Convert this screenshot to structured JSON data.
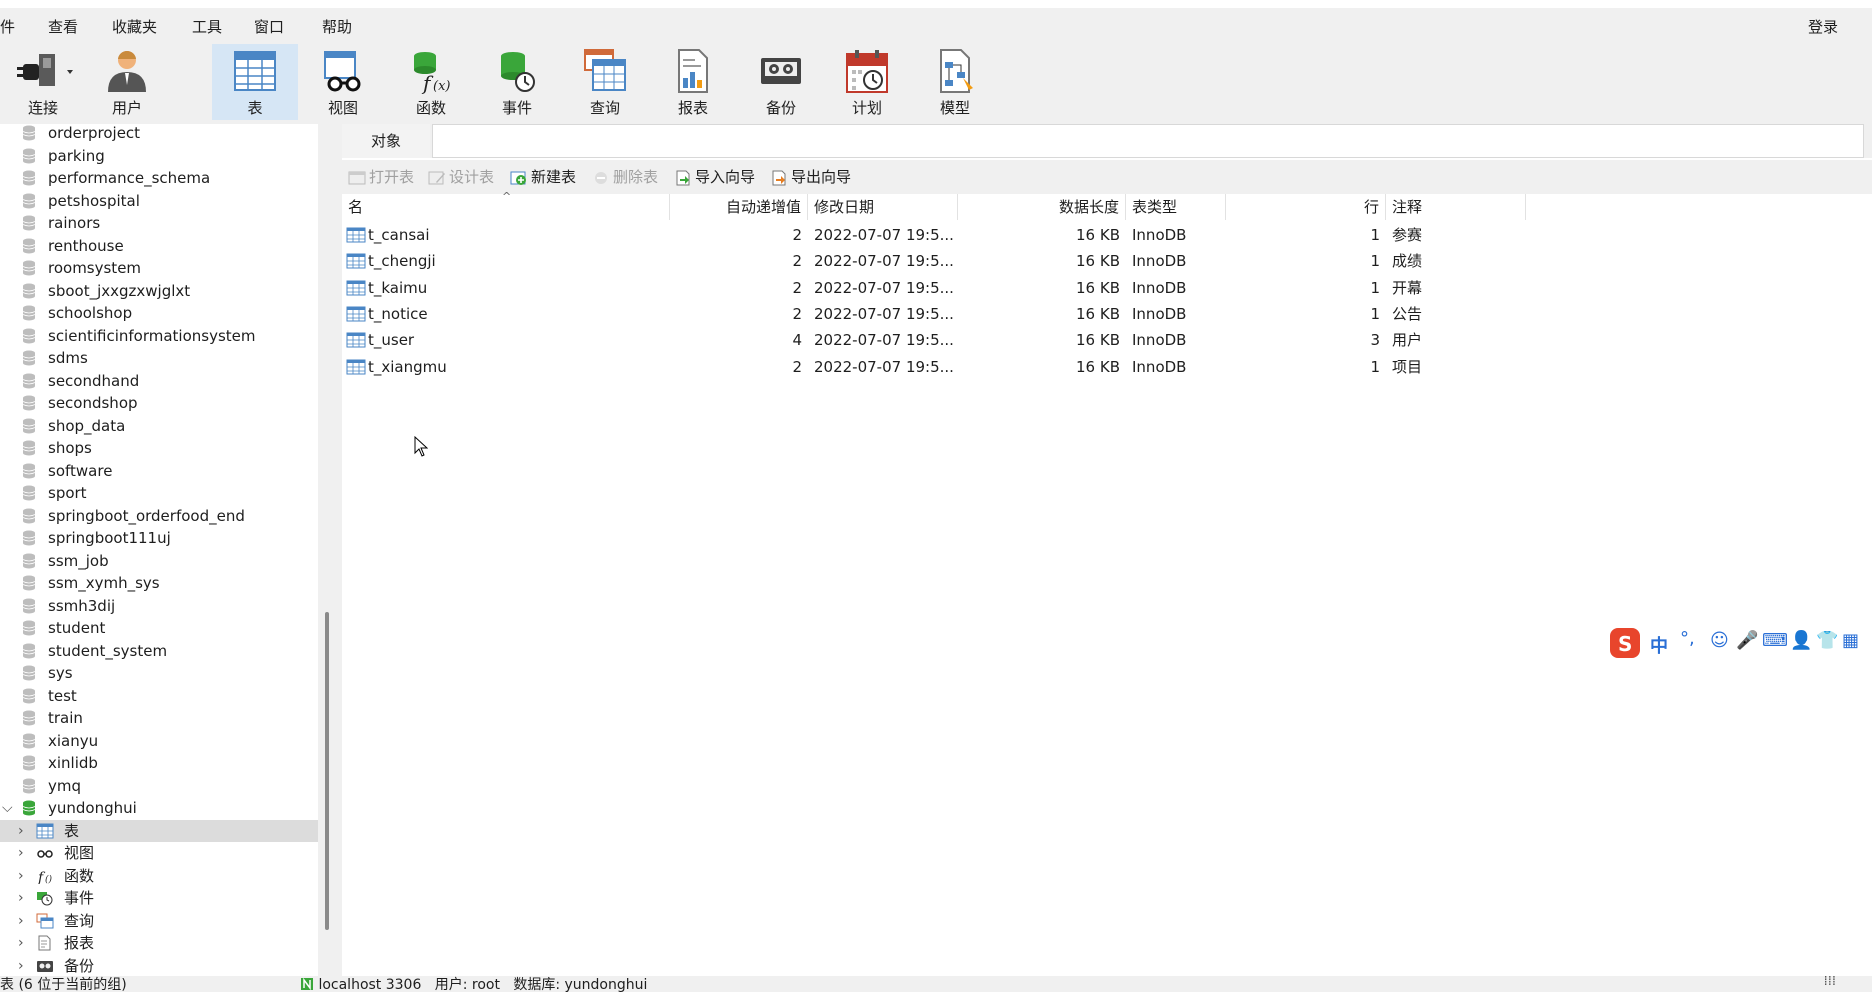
{
  "menu": {
    "items": [
      "文件",
      "查看",
      "收藏夹",
      "工具",
      "窗口",
      "帮助"
    ],
    "file_visible": "件",
    "login": "登录"
  },
  "toolbar": {
    "items": [
      {
        "label": "连接",
        "icon": "plug-icon"
      },
      {
        "label": "用户",
        "icon": "user-icon"
      },
      {
        "label": "表",
        "icon": "table-icon",
        "active": true
      },
      {
        "label": "视图",
        "icon": "view-glasses-icon"
      },
      {
        "label": "函数",
        "icon": "function-icon"
      },
      {
        "label": "事件",
        "icon": "event-clock-icon"
      },
      {
        "label": "查询",
        "icon": "query-icon"
      },
      {
        "label": "报表",
        "icon": "report-icon"
      },
      {
        "label": "备份",
        "icon": "backup-tape-icon"
      },
      {
        "label": "计划",
        "icon": "schedule-calendar-icon"
      },
      {
        "label": "模型",
        "icon": "model-icon"
      }
    ]
  },
  "sidebar": {
    "databases": [
      "orderproject",
      "parking",
      "performance_schema",
      "petshospital",
      "rainors",
      "renthouse",
      "roomsystem",
      "sboot_jxxgzxwjglxt",
      "schoolshop",
      "scientificinformationsystem",
      "sdms",
      "secondhand",
      "secondshop",
      "shop_data",
      "shops",
      "software",
      "sport",
      "springboot_orderfood_end",
      "springboot111uj",
      "ssm_job",
      "ssm_xymh_sys",
      "ssmh3dij",
      "student",
      "student_system",
      "sys",
      "test",
      "train",
      "xianyu",
      "xinlidb",
      "ymq"
    ],
    "open_db": "yundonghui",
    "children": [
      "表",
      "视图",
      "函数",
      "事件",
      "查询",
      "报表",
      "备份"
    ]
  },
  "tabs": {
    "objects": "对象"
  },
  "objbar": {
    "open": "打开表",
    "design": "设计表",
    "new": "新建表",
    "delete": "删除表",
    "import": "导入向导",
    "export": "导出向导"
  },
  "grid": {
    "columns": [
      "名",
      "自动递增值",
      "修改日期",
      "数据长度",
      "表类型",
      "行",
      "注释"
    ],
    "rows": [
      {
        "name": "t_cansai",
        "auto_inc": "2",
        "modified": "2022-07-07 19:5...",
        "size": "16 KB",
        "engine": "InnoDB",
        "rows": "1",
        "comment": "参赛"
      },
      {
        "name": "t_chengji",
        "auto_inc": "2",
        "modified": "2022-07-07 19:5...",
        "size": "16 KB",
        "engine": "InnoDB",
        "rows": "1",
        "comment": "成绩"
      },
      {
        "name": "t_kaimu",
        "auto_inc": "2",
        "modified": "2022-07-07 19:5...",
        "size": "16 KB",
        "engine": "InnoDB",
        "rows": "1",
        "comment": "开幕"
      },
      {
        "name": "t_notice",
        "auto_inc": "2",
        "modified": "2022-07-07 19:5...",
        "size": "16 KB",
        "engine": "InnoDB",
        "rows": "1",
        "comment": "公告"
      },
      {
        "name": "t_user",
        "auto_inc": "4",
        "modified": "2022-07-07 19:5...",
        "size": "16 KB",
        "engine": "InnoDB",
        "rows": "3",
        "comment": "用户"
      },
      {
        "name": "t_xiangmu",
        "auto_inc": "2",
        "modified": "2022-07-07 19:5...",
        "size": "16 KB",
        "engine": "InnoDB",
        "rows": "1",
        "comment": "项目"
      }
    ]
  },
  "ime": {
    "lang": "中"
  },
  "status": {
    "left": "表 (6 位于当前的组)",
    "connection": "localhost 3306",
    "user": "用户: root",
    "database": "数据库: yundonghui"
  },
  "colors": {
    "accent_active": "#d6e6f5",
    "db_icon": "#bdbdbd",
    "db_icon_open": "#3aa63a",
    "table_icon": "#4a86c5"
  }
}
